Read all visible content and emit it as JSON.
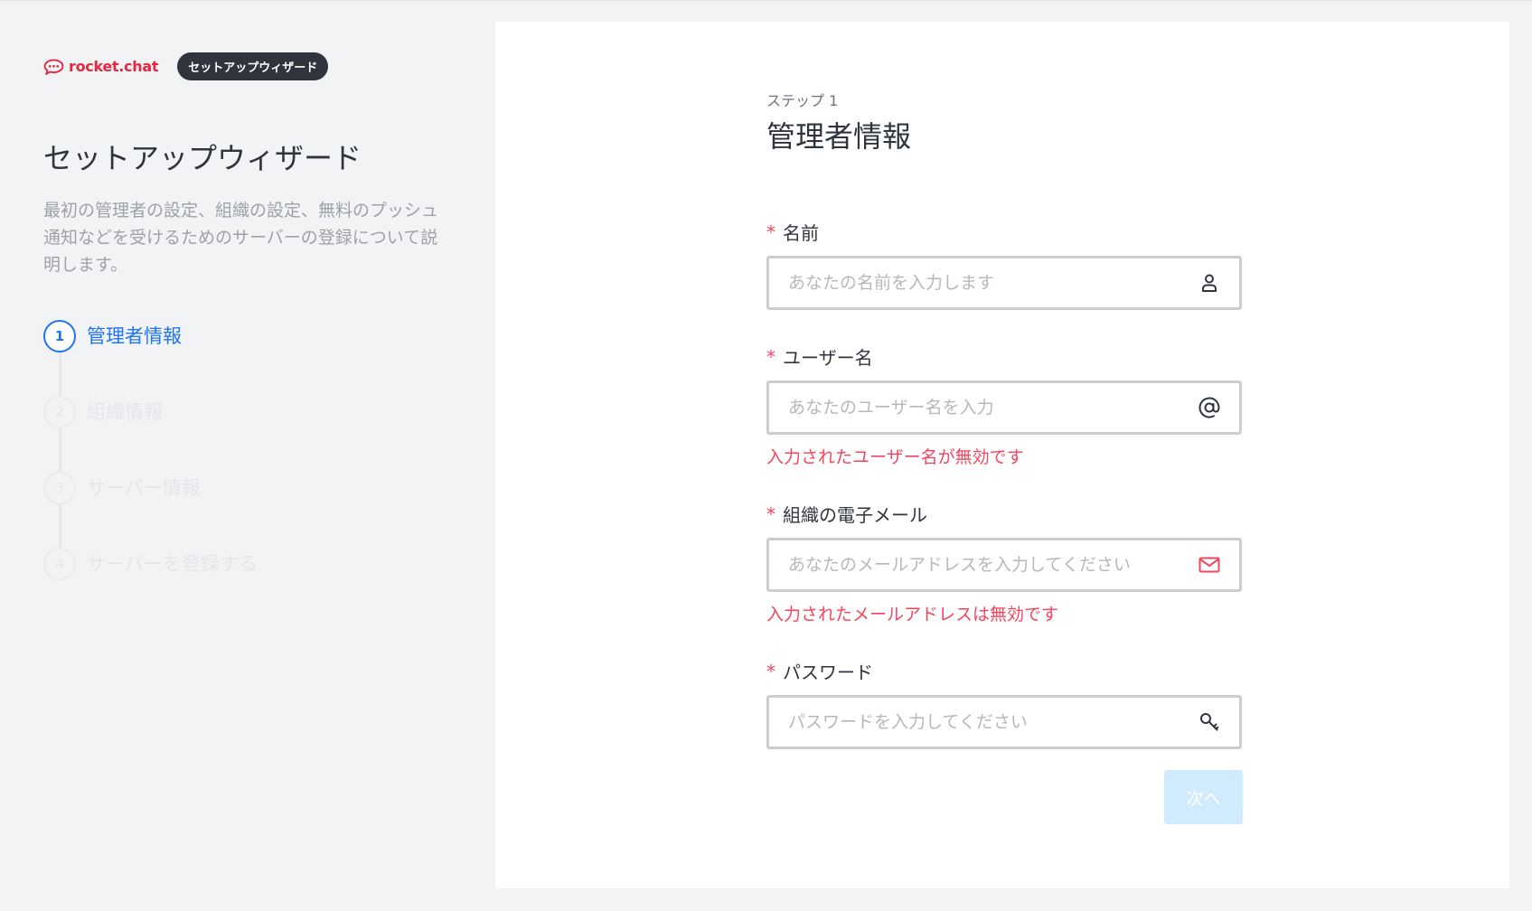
{
  "brand": {
    "logo_text": "rocket.chat",
    "tag": "セットアップウィザード"
  },
  "sidebar": {
    "title": "セットアップウィザード",
    "description": "最初の管理者の設定、組織の設定、無料のプッシュ通知などを受けるためのサーバーの登録について説明します。",
    "steps": [
      {
        "num": "1",
        "label": "管理者情報",
        "active": true
      },
      {
        "num": "2",
        "label": "組織情報",
        "active": false
      },
      {
        "num": "3",
        "label": "サーバー情報",
        "active": false
      },
      {
        "num": "4",
        "label": "サーバーを登録する",
        "active": false
      }
    ]
  },
  "form": {
    "kicker": "ステップ 1",
    "title": "管理者情報",
    "required_mark": "*",
    "fields": [
      {
        "label": "名前",
        "placeholder": "あなたの名前を入力します",
        "value": "",
        "icon": "user-icon",
        "error": ""
      },
      {
        "label": "ユーザー名",
        "placeholder": "あなたのユーザー名を入力",
        "value": "",
        "icon": "at-sign-icon",
        "error": "入力されたユーザー名が無効です"
      },
      {
        "label": "組織の電子メール",
        "placeholder": "あなたのメールアドレスを入力してください",
        "value": "",
        "icon": "mail-icon",
        "error": "入力されたメールアドレスは無効です"
      },
      {
        "label": "パスワード",
        "placeholder": "パスワードを入力してください",
        "value": "",
        "icon": "key-icon",
        "error": ""
      }
    ],
    "next_label": "次へ"
  },
  "colors": {
    "accent": "#1d74f5",
    "error": "#f5455c",
    "brand": "#e4283f",
    "button_disabled": "#d1ebfe"
  }
}
